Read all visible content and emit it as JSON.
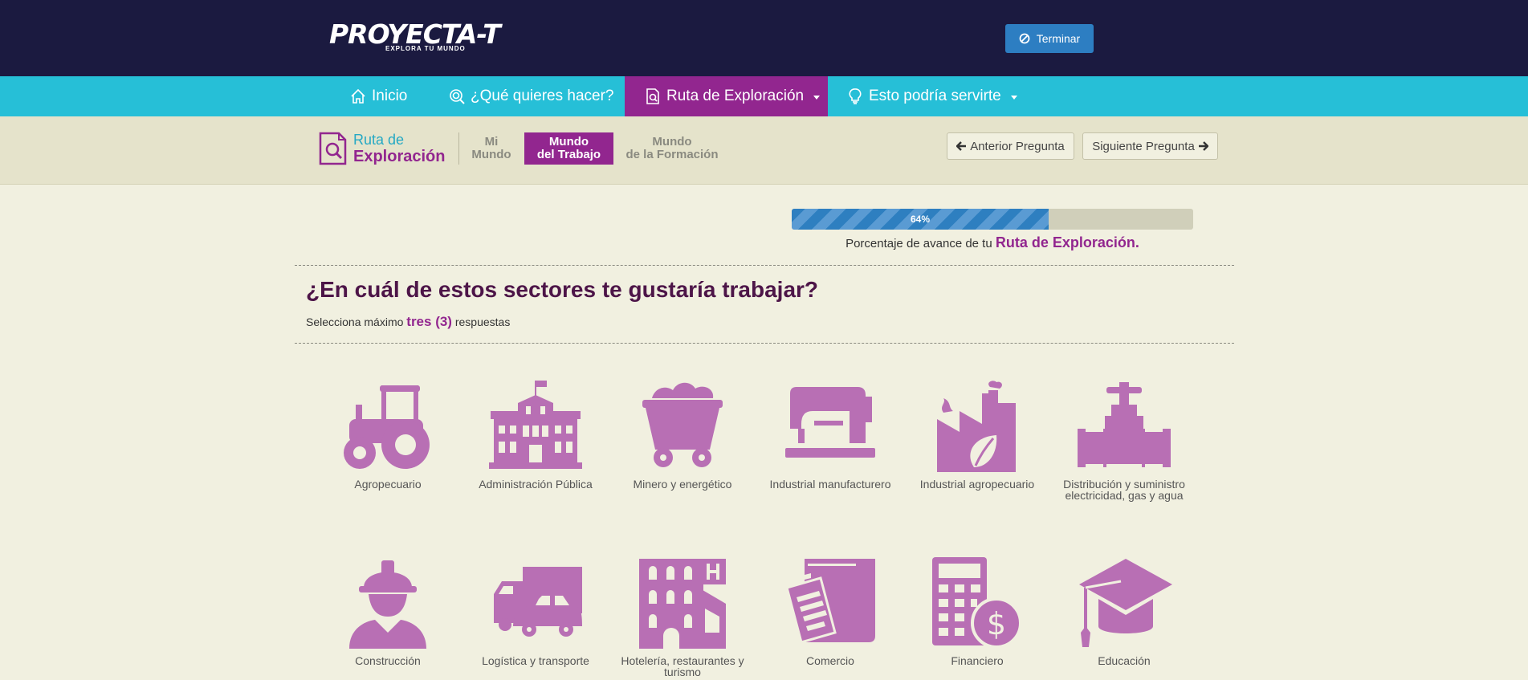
{
  "header": {
    "logo_main": "PROYECTA-T",
    "logo_sub": "EXPLORA TU MUNDO",
    "terminar_label": "Terminar"
  },
  "nav": {
    "items": [
      {
        "label": "Inicio",
        "icon": "home-icon"
      },
      {
        "label": "¿Qué quieres hacer?",
        "icon": "target-search-icon"
      },
      {
        "label": "Ruta de Exploración",
        "icon": "doc-search-icon"
      },
      {
        "label": "Esto podría servirte",
        "icon": "lightbulb-icon"
      }
    ]
  },
  "subbar": {
    "ruta_line1": "Ruta de",
    "ruta_line2": "Exploración",
    "steps": [
      {
        "line1": "Mi",
        "line2": "Mundo"
      },
      {
        "line1": "Mundo",
        "line2": "del Trabajo"
      },
      {
        "line1": "Mundo",
        "line2": "de la Formación"
      }
    ],
    "prev_label": "Anterior Pregunta",
    "next_label": "Siguiente Pregunta"
  },
  "progress": {
    "percent": 64,
    "label": "64%",
    "caption_prefix": "Porcentaje de avance de tu",
    "caption_bold": "Ruta de Exploración."
  },
  "question": {
    "title": "¿En cuál de estos sectores te gustaría trabajar?",
    "instruction_prefix": "Selecciona máximo",
    "instruction_bold": "tres (3)",
    "instruction_suffix": "respuestas"
  },
  "options": [
    {
      "label": "Agropecuario",
      "icon": "tractor-icon"
    },
    {
      "label": "Administración Pública",
      "icon": "government-building-icon"
    },
    {
      "label": "Minero y energético",
      "icon": "mine-cart-icon"
    },
    {
      "label": "Industrial manufacturero",
      "icon": "sewing-machine-icon"
    },
    {
      "label": "Industrial agropecuario",
      "icon": "factory-leaf-icon"
    },
    {
      "label": "Distribución y suministro electricidad, gas y agua",
      "icon": "pipe-valve-icon"
    },
    {
      "label": "Construcción",
      "icon": "construction-worker-icon"
    },
    {
      "label": "Logística y transporte",
      "icon": "truck-car-icon"
    },
    {
      "label": "Hotelería, restaurantes y turismo",
      "icon": "hotel-icon"
    },
    {
      "label": "Comercio",
      "icon": "clipboard-box-icon"
    },
    {
      "label": "Financiero",
      "icon": "calculator-dollar-icon"
    },
    {
      "label": "Educación",
      "icon": "graduation-cap-icon"
    }
  ],
  "colors": {
    "header_bg": "#1b1a40",
    "nav_bg": "#26bfd7",
    "accent_purple": "#92268f",
    "icon_purple": "#b86fb4",
    "progress_blue": "#2e7fc0",
    "page_bg": "#f1f0e0"
  }
}
